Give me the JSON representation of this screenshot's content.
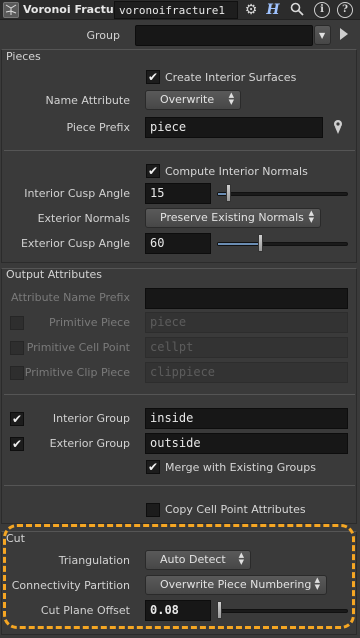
{
  "header": {
    "node_type": "Voronoi Fracture",
    "node_name": "voronoifracture1",
    "icons": [
      "voronoi-node-icon",
      "gear-icon",
      "houdini-help-icon",
      "search-icon",
      "info-icon",
      "help-icon"
    ]
  },
  "group": {
    "label": "Group",
    "value": ""
  },
  "pieces": {
    "title": "Pieces",
    "create_interior_surfaces": {
      "label": "Create Interior Surfaces",
      "checked": true
    },
    "name_attribute": {
      "label": "Name Attribute",
      "value": "Overwrite"
    },
    "piece_prefix": {
      "label": "Piece Prefix",
      "value": "piece"
    },
    "compute_interior_normals": {
      "label": "Compute Interior Normals",
      "checked": true
    },
    "interior_cusp_angle": {
      "label": "Interior Cusp Angle",
      "value": "15",
      "fraction": 0.07
    },
    "exterior_normals": {
      "label": "Exterior Normals",
      "value": "Preserve Existing Normals"
    },
    "exterior_cusp_angle": {
      "label": "Exterior Cusp Angle",
      "value": "60",
      "fraction": 0.32
    }
  },
  "output_attributes": {
    "title": "Output Attributes",
    "attribute_name_prefix": {
      "label": "Attribute Name Prefix",
      "value": ""
    },
    "primitive_piece": {
      "label": "Primitive Piece",
      "value": "piece",
      "checked": false
    },
    "primitive_cell_point": {
      "label": "Primitive Cell Point",
      "value": "cellpt",
      "checked": false
    },
    "primitive_clip_piece": {
      "label": "Primitive Clip Piece",
      "value": "clippiece",
      "checked": false
    },
    "interior_group": {
      "label": "Interior Group",
      "value": "inside",
      "checked": true
    },
    "exterior_group": {
      "label": "Exterior Group",
      "value": "outside",
      "checked": true
    },
    "merge_existing_groups": {
      "label": "Merge with Existing Groups",
      "checked": true
    },
    "copy_cell_point_attributes": {
      "label": "Copy Cell Point Attributes",
      "checked": false
    }
  },
  "cut": {
    "title": "Cut",
    "triangulation": {
      "label": "Triangulation",
      "value": "Auto Detect"
    },
    "connectivity_partition": {
      "label": "Connectivity Partition",
      "value": "Overwrite Piece Numbering"
    },
    "cut_plane_offset": {
      "label": "Cut Plane Offset",
      "value": "0.08",
      "fraction": 0.0
    }
  },
  "colors": {
    "highlight": "#f5a623",
    "slider_fill": "#6b8db3",
    "panel_bg": "#3a3a3a"
  }
}
